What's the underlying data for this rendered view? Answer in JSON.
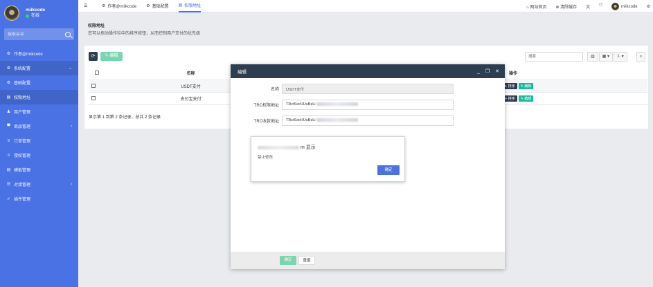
{
  "sidebar": {
    "brand_name": "miikcode",
    "status": "在线",
    "search_placeholder": "搜索菜单",
    "items": [
      {
        "label": "作者@miikcode",
        "icon": "dashboard-icon"
      },
      {
        "label": "系统配置",
        "icon": "gear-icon",
        "expanded": true
      },
      {
        "label": "基础配置",
        "icon": "gear-icon"
      },
      {
        "label": "权限地址",
        "icon": "list-icon"
      },
      {
        "label": "用户管理",
        "icon": "user-icon"
      },
      {
        "label": "商品管理",
        "icon": "cart-icon",
        "collapsible": true
      },
      {
        "label": "订单管理",
        "icon": "list-icon"
      },
      {
        "label": "授权管理",
        "icon": "list-icon"
      },
      {
        "label": "模板管理",
        "icon": "list-icon"
      },
      {
        "label": "对接管理",
        "icon": "list-icon",
        "collapsible": true
      },
      {
        "label": "插件管理",
        "icon": "rocket-icon"
      }
    ]
  },
  "topbar": {
    "tabs": [
      {
        "label": "作者@miikcode",
        "icon": "dashboard-icon"
      },
      {
        "label": "基础配置",
        "icon": "gear-icon"
      },
      {
        "label": "权限地址",
        "icon": "list-icon",
        "active": true
      }
    ],
    "right": {
      "home": "网站首页",
      "clear_cache": "清除缓存",
      "user": "miikcode"
    }
  },
  "page": {
    "title": "权限地址",
    "description": "您可以拖动操作栏中的排序按钮，从而控制用户支付的优先级"
  },
  "toolbar": {
    "edit_label": "编辑",
    "search_placeholder": "搜索"
  },
  "table": {
    "columns": [
      "名称",
      "操作"
    ],
    "rows": [
      {
        "name": "USDT支付"
      },
      {
        "name": "支付宝支付"
      }
    ],
    "sort_label": "排序",
    "edit_label": "编辑",
    "pagination": "显示第 1 到第 2 条记录，总共 2 条记录"
  },
  "modal": {
    "title": "编辑",
    "fields": [
      {
        "label": "名称",
        "value": "USDT支付",
        "readonly": true
      },
      {
        "label": "TRC权限地址",
        "value": "TRctSxcHUuBzLi"
      },
      {
        "label": "TRC收款地址",
        "value": "TRctSxcHUuBzLi"
      }
    ],
    "ok_label": "确定",
    "reset_label": "重置"
  },
  "alert": {
    "title_suffix": "m 显示",
    "message": "禁止修改",
    "ok_label": "确定"
  },
  "colors": {
    "sidebar": "#4a72e4",
    "modal_header": "#2c3e50",
    "success": "#18bc9c",
    "primary": "#4a72e4"
  }
}
